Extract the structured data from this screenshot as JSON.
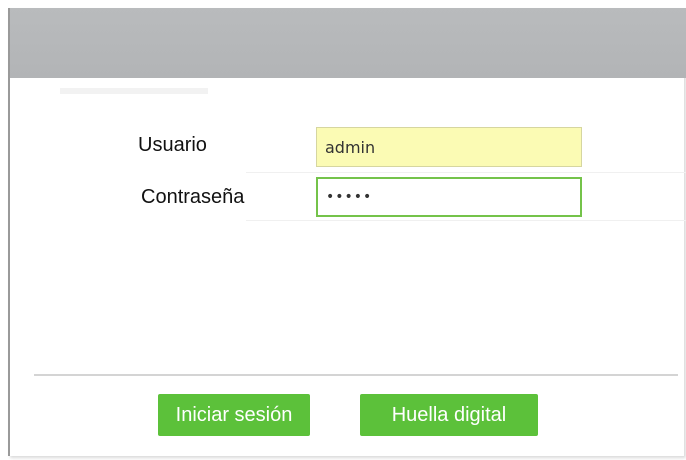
{
  "form": {
    "username_label": "Usuario",
    "username_value": "admin",
    "password_label": "Contraseña",
    "password_value": "•••••"
  },
  "buttons": {
    "login_label": "Iniciar sesión",
    "fingerprint_label": "Huella digital"
  },
  "colors": {
    "titlebar": "#b5b7b9",
    "button_green": "#5cc13a",
    "username_field_bg": "#fbfbb4",
    "password_border": "#74c34a"
  }
}
